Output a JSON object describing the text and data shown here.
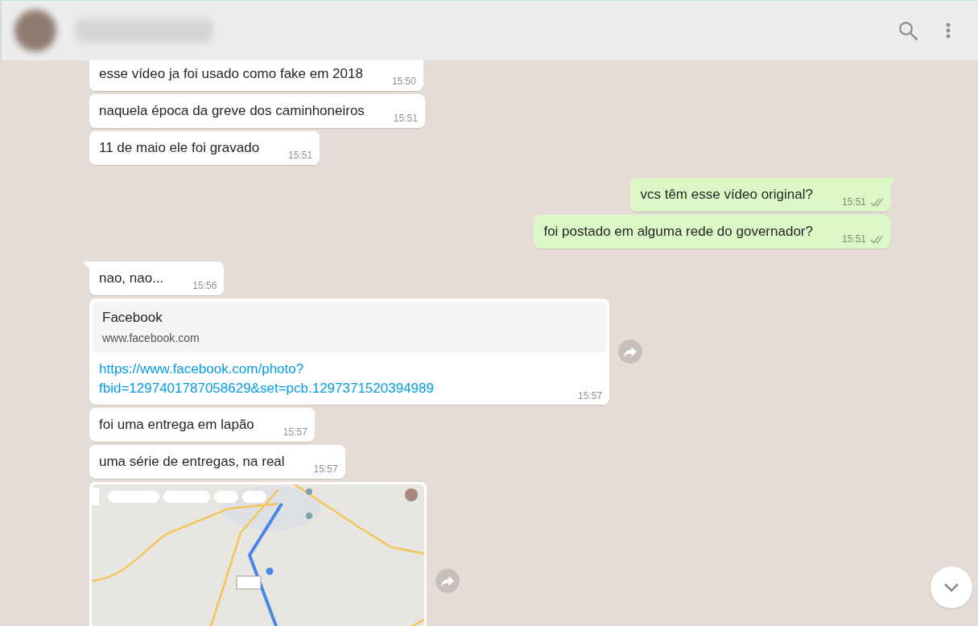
{
  "header": {
    "contact_name_hidden": true
  },
  "messages": [
    {
      "kind": "text",
      "outgoing": false,
      "tail": false,
      "text": "esse vídeo ja foi usado como fake em 2018",
      "time": "15:50",
      "forward": false
    },
    {
      "kind": "text",
      "outgoing": false,
      "tail": false,
      "text": "naquela época da greve dos caminhoneiros",
      "time": "15:51",
      "forward": false
    },
    {
      "kind": "text",
      "outgoing": false,
      "tail": false,
      "text": "11 de maio ele foi gravado",
      "time": "15:51",
      "forward": false
    },
    {
      "kind": "text",
      "outgoing": true,
      "tail": true,
      "text": "vcs têm esse vídeo original?",
      "time": "15:51",
      "read": false,
      "forward": false
    },
    {
      "kind": "text",
      "outgoing": true,
      "tail": false,
      "text": "foi postado em alguma rede do governador?",
      "time": "15:51",
      "read": false,
      "forward": false
    },
    {
      "kind": "text",
      "outgoing": false,
      "tail": true,
      "text": "nao, nao...",
      "time": "15:56",
      "forward": false
    },
    {
      "kind": "link",
      "outgoing": false,
      "tail": false,
      "preview_title": "Facebook",
      "preview_domain": "www.facebook.com",
      "url": "https://www.facebook.com/photo?fbid=1297401787058629&set=pcb.1297371520394989",
      "time": "15:57",
      "forward": true
    },
    {
      "kind": "text",
      "outgoing": false,
      "tail": false,
      "text": "foi uma entrega em lapão",
      "time": "15:57",
      "forward": false
    },
    {
      "kind": "text",
      "outgoing": false,
      "tail": false,
      "text": "uma série de entregas, na real",
      "time": "15:57",
      "forward": false
    },
    {
      "kind": "image",
      "outgoing": false,
      "tail": false,
      "forward": true
    }
  ]
}
